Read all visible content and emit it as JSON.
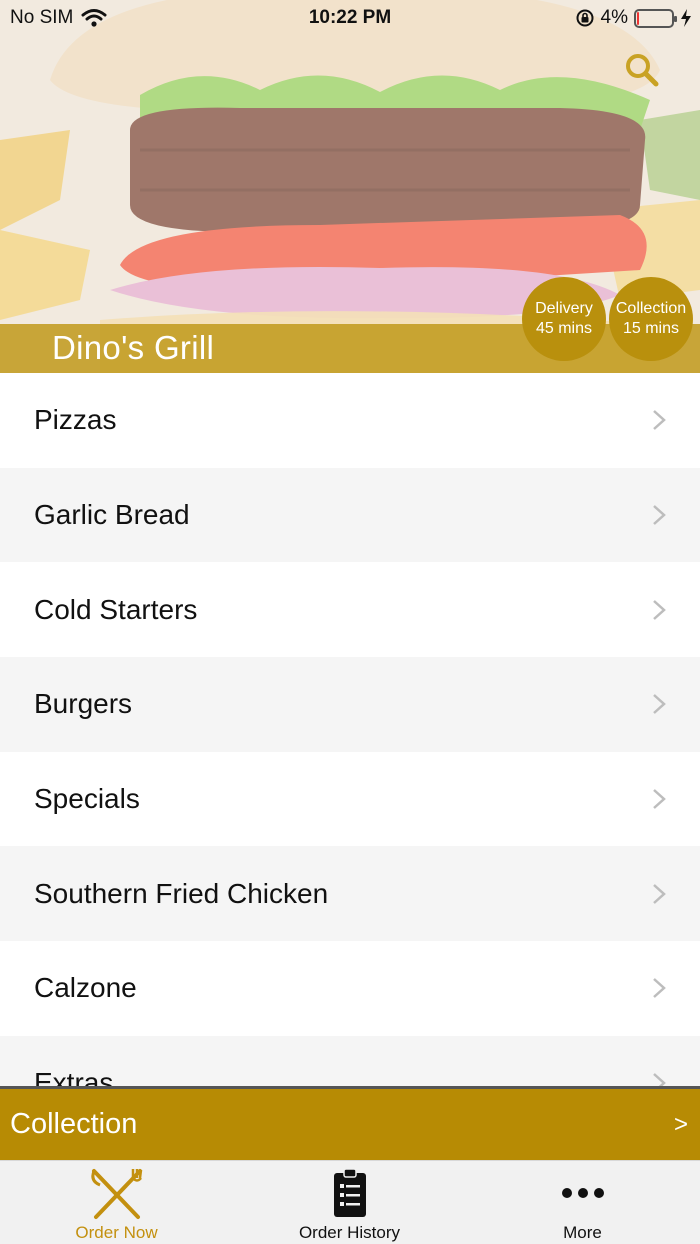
{
  "status_bar": {
    "carrier": "No SIM",
    "time": "10:22 PM",
    "battery_percent_label": "4%",
    "battery_level": 0.04
  },
  "restaurant": {
    "name": "Dino's Grill",
    "delivery": {
      "title": "Delivery",
      "time": "45 mins"
    },
    "collection": {
      "title": "Collection",
      "time": "15 mins"
    }
  },
  "menu": {
    "items": [
      {
        "label": "Pizzas"
      },
      {
        "label": "Garlic Bread"
      },
      {
        "label": "Cold Starters"
      },
      {
        "label": "Burgers"
      },
      {
        "label": "Specials"
      },
      {
        "label": "Southern Fried Chicken"
      },
      {
        "label": "Calzone"
      },
      {
        "label": "Extras"
      }
    ]
  },
  "order_mode": {
    "label": "Collection",
    "arrow": ">"
  },
  "tabs": [
    {
      "label": "Order Now",
      "icon": "fork-knife-icon",
      "active": true
    },
    {
      "label": "Order History",
      "icon": "clipboard-list-icon",
      "active": false
    },
    {
      "label": "More",
      "icon": "more-dots-icon",
      "active": false
    }
  ],
  "colors": {
    "accent": "#b78b04",
    "active_tab": "#c3900f"
  }
}
